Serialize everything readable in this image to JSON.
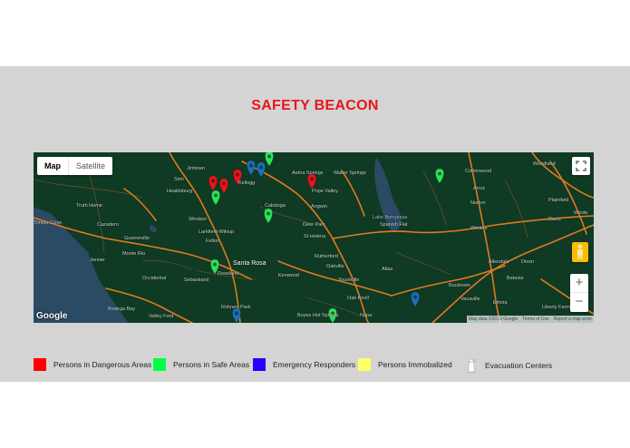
{
  "page": {
    "title": "SAFETY BEACON"
  },
  "map": {
    "controls": {
      "map_label": "Map",
      "satellite_label": "Satellite",
      "zoom_in": "+",
      "zoom_out": "−",
      "fullscreen_icon": "fullscreen-icon",
      "pegman_icon": "pegman-icon"
    },
    "logo": "Google",
    "attribution": {
      "data": "Map data ©2019 Google",
      "terms": "Terms of Use",
      "report": "Report a map error"
    },
    "places": [
      "Jimtown",
      "Simi",
      "Healdsburg",
      "Kellogg",
      "Aetna Springs",
      "Walter Springs",
      "Pope Valley",
      "Cottonwood",
      "Woodland",
      "Truth Home",
      "Timber Cove",
      "Cazadero",
      "Windsor",
      "Calistoga",
      "Angwin",
      "Deer Park",
      "St Helena",
      "Arroz",
      "Norton",
      "Plainfield",
      "Lake Berryessa",
      "Spanish Flat",
      "Davis",
      "Guerneville",
      "Larkfield-Wikiup",
      "Fulton",
      "Monte Rio",
      "Jenner",
      "Winters",
      "Santa Rosa",
      "Roseland",
      "Sebastopol",
      "Occidental",
      "Kenwood",
      "Rutherford",
      "Oakville",
      "Yountville",
      "Atlas",
      "Allendale",
      "Dixon",
      "Batavia",
      "Oak Knoll",
      "Bucktown",
      "Vacaville",
      "Elmira",
      "Bodega Bay",
      "Valley Ford",
      "Rohnert Park",
      "Boyes Hot Springs",
      "Napa",
      "Liberty Farms",
      "Weste"
    ],
    "pin_colors": {
      "danger": "#e8161b",
      "safe": "#2ee35a",
      "responder": "#1d6fb8"
    }
  },
  "legend": [
    {
      "label": "Persons in Dangerous Areas",
      "color": "#ff0000",
      "icon": "red-square"
    },
    {
      "label": "Persons in Safe Areas",
      "color": "#00ff44",
      "icon": "green-square"
    },
    {
      "label": "Emergency Responders",
      "color": "#2600ff",
      "icon": "blue-square"
    },
    {
      "label": "Persons Immobalized",
      "color": "#ffff66",
      "icon": "yellow-square"
    },
    {
      "label": "Evacuation Centers",
      "color": "#ffffff",
      "icon": "lighthouse-icon"
    }
  ]
}
